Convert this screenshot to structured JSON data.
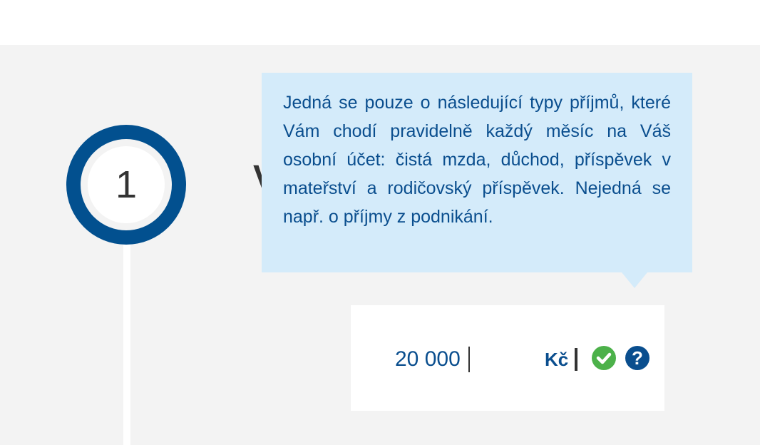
{
  "step": {
    "number": "1"
  },
  "heading": {
    "visible_fragment": "V"
  },
  "tooltip": {
    "text": "Jedná se pouze o následující typy příjmů, které Vám chodí pravidelně každý měsíc na Váš osobní účet: čistá mzda, důchod, příspěvek v mateřství a rodičovský příspěvek. Nejedná se např. o příjmy z podnikání."
  },
  "income_input": {
    "value": "20 000",
    "currency": "Kč",
    "valid_icon": "check-circle-icon",
    "help_icon_label": "?"
  },
  "colors": {
    "primary_blue": "#02508f",
    "tooltip_bg": "#d4ebfa",
    "success_green": "#4cb14a",
    "background_gray": "#f3f3f3"
  }
}
